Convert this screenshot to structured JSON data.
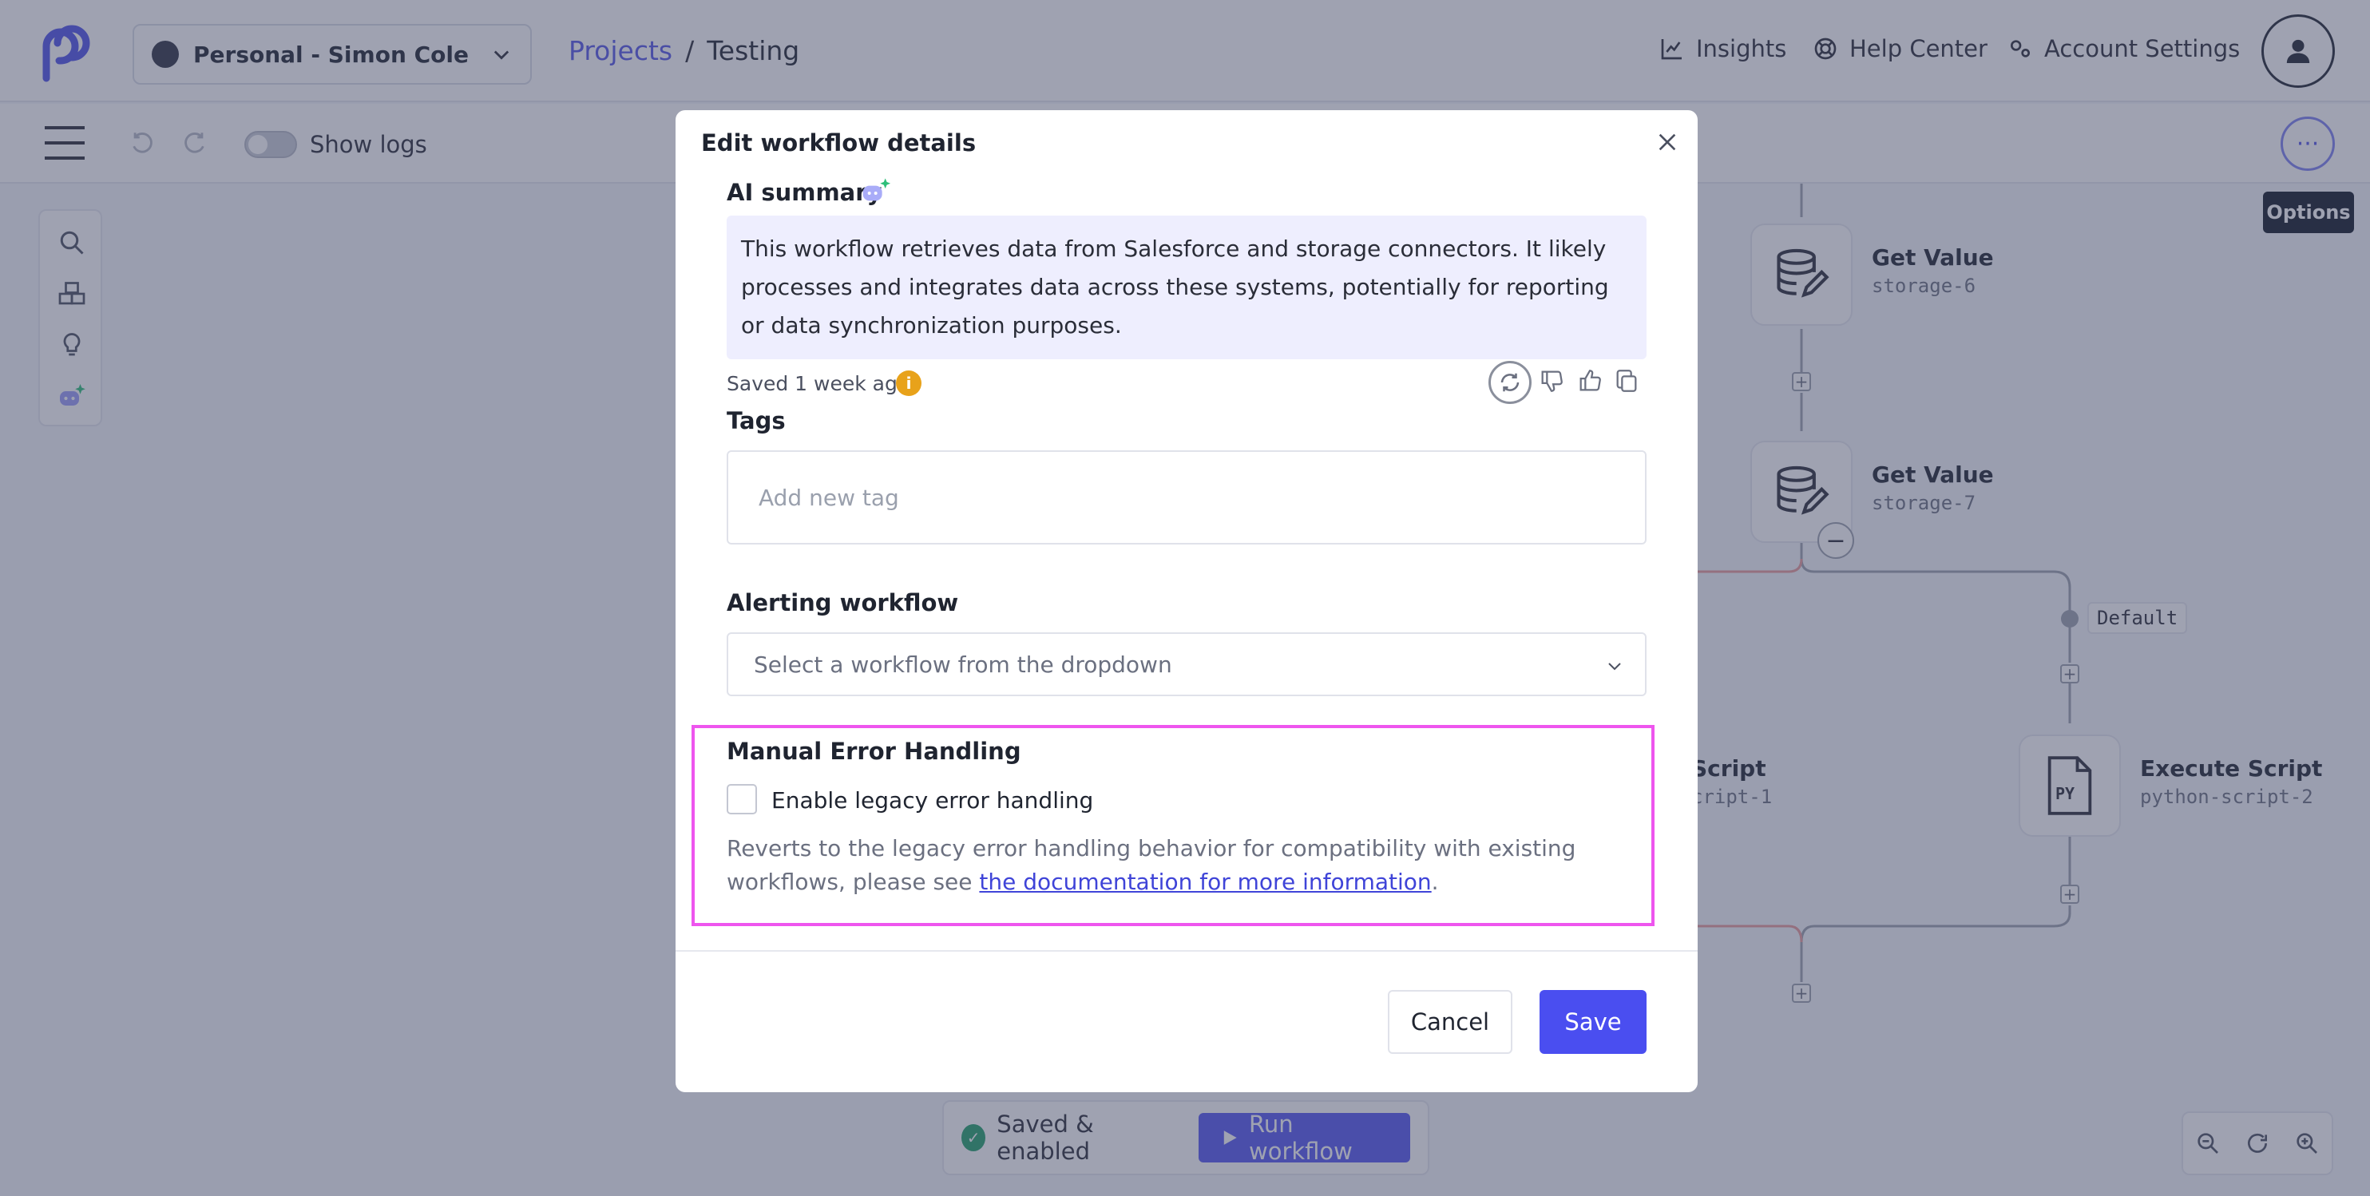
{
  "header": {
    "workspace": "Personal - Simon Cole",
    "breadcrumb": {
      "projects": "Projects",
      "separator": "/",
      "current": "Testing"
    },
    "nav": {
      "insights": "Insights",
      "help": "Help Center",
      "account": "Account Settings"
    }
  },
  "toolbar": {
    "show_logs": "Show logs",
    "options_tooltip": "Options",
    "options_glyph": "···"
  },
  "canvas": {
    "nodes": [
      {
        "title": "Get Value",
        "sub": "storage-6"
      },
      {
        "title": "Get Value",
        "sub": "storage-7"
      },
      {
        "title": "Script",
        "sub": "cript-1"
      },
      {
        "title": "Execute Script",
        "sub": "python-script-2"
      }
    ],
    "default_label": "Default",
    "py_label": "PY",
    "minus_glyph": "−",
    "plus_glyph": "+"
  },
  "runbar": {
    "status": "Saved & enabled",
    "run": "Run workflow"
  },
  "modal": {
    "title": "Edit workflow details",
    "ai_label": "AI summary",
    "ai_text": "This workflow retrieves data from Salesforce and storage connectors. It likely processes and integrates data across these systems, potentially for reporting or data synchronization purposes.",
    "saved_ago": "Saved 1 week ago",
    "info_glyph": "i",
    "tags_label": "Tags",
    "tags_placeholder": "Add new tag",
    "alert_label": "Alerting workflow",
    "alert_placeholder": "Select a workflow from the dropdown",
    "error_title": "Manual Error Handling",
    "error_checkbox": "Enable legacy error handling",
    "error_desc_before": "Reverts to the legacy error handling behavior for compatibility with existing workflows, please see ",
    "error_desc_link": "the documentation for more information",
    "error_desc_after": ".",
    "cancel": "Cancel",
    "save": "Save"
  },
  "colors": {
    "accent": "#4a4ef0",
    "highlight": "#ee55ee",
    "ai_bg": "#eeeefe",
    "warning": "#e8a21a"
  },
  "icons": [
    "logo-icon",
    "chevron-down-icon",
    "insights-icon",
    "help-icon",
    "settings-icon",
    "user-icon",
    "menu-icon",
    "undo-icon",
    "redo-icon",
    "search-icon",
    "cubes-icon",
    "bulb-icon",
    "ai-icon",
    "close-icon",
    "regenerate-icon",
    "thumbs-down-icon",
    "thumbs-up-icon",
    "copy-icon",
    "zoom-out-icon",
    "reset-icon",
    "zoom-in-icon"
  ]
}
